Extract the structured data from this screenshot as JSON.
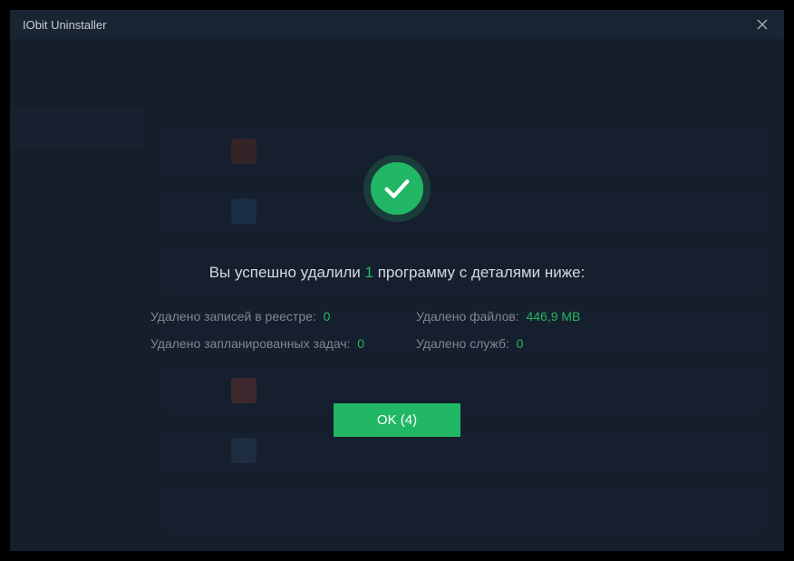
{
  "window": {
    "title": "IObit Uninstaller"
  },
  "modal": {
    "headline_pre": "Вы успешно удалили ",
    "headline_count": "1",
    "headline_post": " программу с деталями ниже:",
    "stats": {
      "registry_label": "Удалено записей в реестре:",
      "registry_value": "0",
      "files_label": "Удалено файлов:",
      "files_value": "446,9 MB",
      "tasks_label": "Удалено запланированных задач:",
      "tasks_value": "0",
      "services_label": "Удалено служб:",
      "services_value": "0"
    },
    "ok_label": "OK (4)"
  }
}
